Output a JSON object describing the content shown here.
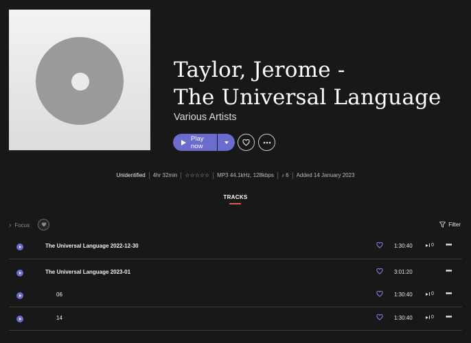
{
  "album": {
    "title_line1": "Taylor, Jerome -",
    "title_line2": "The Universal Language",
    "artist": "Various Artists"
  },
  "actions": {
    "play_label": "Play now"
  },
  "meta": {
    "status": "Unidentified",
    "duration": "4hr 32min",
    "rating": "☆☆☆☆☆",
    "format": "MP3 44.1kHz, 128kbps",
    "count": "6",
    "added": "Added 14 January 2023"
  },
  "tabs": {
    "tracks": "TRACKS"
  },
  "toolbar": {
    "focus": "Focus",
    "filter": "Filter"
  },
  "tracks": [
    {
      "name": "The Universal Language 2022-12-30",
      "duration": "1:30:40",
      "plays": "0",
      "bold": true
    },
    {
      "name": "The Universal Language 2023-01",
      "duration": "3:01:20",
      "plays": "",
      "bold": true
    },
    {
      "name": "06",
      "duration": "1:30:40",
      "plays": "0",
      "bold": false
    },
    {
      "name": "14",
      "duration": "1:30:40",
      "plays": "0",
      "bold": false
    }
  ],
  "colors": {
    "accent": "#6c6ccf",
    "tab_underline": "#e05a4e",
    "background": "#181818"
  }
}
